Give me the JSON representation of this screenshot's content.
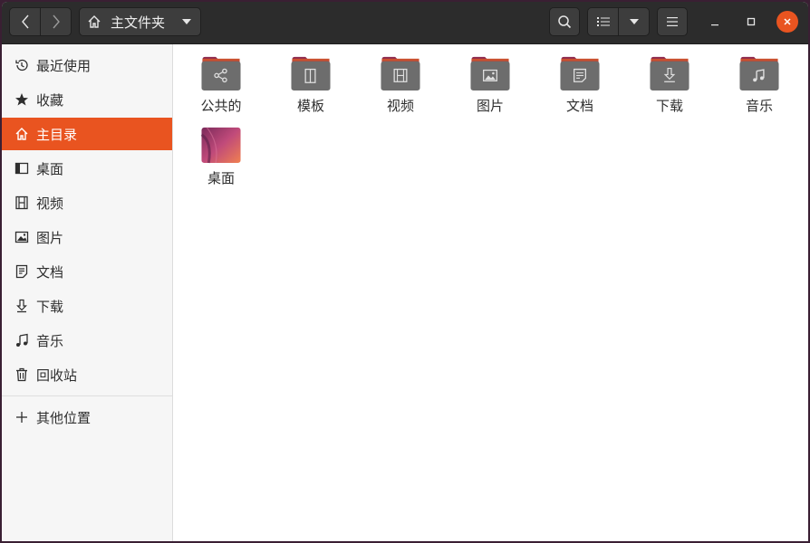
{
  "header": {
    "path_label": "主文件夹",
    "icons": {
      "back": "chevron-left-icon",
      "forward": "chevron-right-icon",
      "home": "home-icon",
      "path_menu": "triangle-down-icon",
      "search": "search-icon",
      "view_list": "list-view-icon",
      "view_options": "triangle-down-icon",
      "menu": "hamburger-menu-icon",
      "minimize": "minimize-icon",
      "maximize": "maximize-icon",
      "close": "close-icon"
    },
    "close_color": "#e95420"
  },
  "sidebar": {
    "items": [
      {
        "label": "最近使用",
        "icon": "clock-icon"
      },
      {
        "label": "收藏",
        "icon": "star-icon"
      },
      {
        "label": "主目录",
        "icon": "home-icon",
        "active": true
      },
      {
        "label": "桌面",
        "icon": "desktop-icon"
      },
      {
        "label": "视频",
        "icon": "film-icon"
      },
      {
        "label": "图片",
        "icon": "image-icon"
      },
      {
        "label": "文档",
        "icon": "document-icon"
      },
      {
        "label": "下载",
        "icon": "download-icon"
      },
      {
        "label": "音乐",
        "icon": "music-icon"
      },
      {
        "label": "回收站",
        "icon": "trash-icon"
      }
    ],
    "other_locations": {
      "label": "其他位置",
      "icon": "plus-icon"
    },
    "accent": "#e95420"
  },
  "files": [
    {
      "name": "公共的",
      "icon": "share-folder-icon"
    },
    {
      "name": "模板",
      "icon": "template-folder-icon"
    },
    {
      "name": "视频",
      "icon": "video-folder-icon"
    },
    {
      "name": "图片",
      "icon": "pictures-folder-icon"
    },
    {
      "name": "文档",
      "icon": "documents-folder-icon"
    },
    {
      "name": "下载",
      "icon": "download-folder-icon"
    },
    {
      "name": "音乐",
      "icon": "music-folder-icon"
    },
    {
      "name": "桌面",
      "icon": "desktop-folder-icon"
    }
  ],
  "colors": {
    "folder_tab": "#8e2a4e",
    "folder_body": "#6d6d6d",
    "header_bg": "#2c2c2c"
  }
}
